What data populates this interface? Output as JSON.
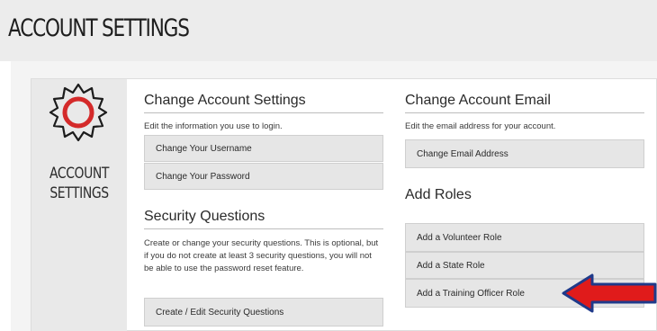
{
  "page": {
    "title": "ACCOUNT SETTINGS"
  },
  "sidebar": {
    "label_line1": "ACCOUNT",
    "label_line2": "SETTINGS",
    "icon": "gear-icon"
  },
  "change_settings": {
    "heading": "Change Account Settings",
    "description": "Edit the information you use to login.",
    "buttons": [
      "Change Your Username",
      "Change Your Password"
    ]
  },
  "security_questions": {
    "heading": "Security Questions",
    "description": "Create or change your security questions. This is optional, but if you do not create at least 3 security questions, you will not be able to use the password reset feature.",
    "button": "Create / Edit Security Questions"
  },
  "change_email": {
    "heading": "Change Account Email",
    "description": "Edit the email address for your account.",
    "button": "Change Email Address"
  },
  "add_roles": {
    "heading": "Add Roles",
    "buttons": [
      "Add a Volunteer Role",
      "Add a State Role",
      "Add a Training Officer Role"
    ]
  },
  "colors": {
    "gear_ring": "#d42a2a",
    "arrow_fill": "#e01b1b",
    "arrow_border": "#1f3a8a",
    "button_bg": "#e6e6e6"
  }
}
